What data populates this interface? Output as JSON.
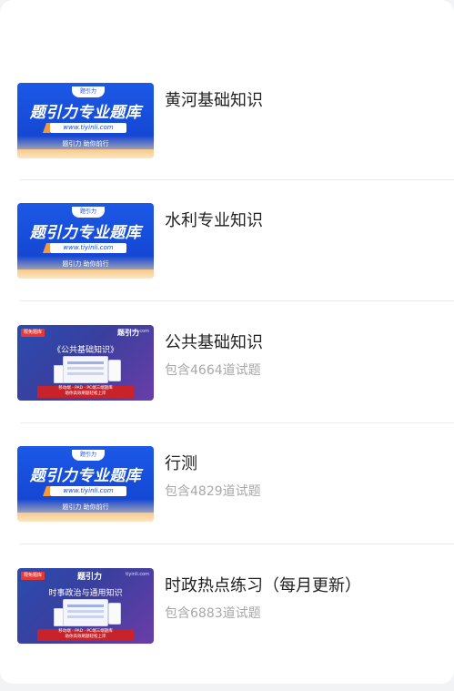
{
  "items": [
    {
      "title": "黄河基础知识",
      "subtitle": "",
      "thumb": {
        "style": "blue-banner",
        "logo": "题引力",
        "headline": "题引力专业题库",
        "url": "www.tiyinli.com",
        "slogan": "题引力 助你前行"
      }
    },
    {
      "title": "水利专业知识",
      "subtitle": "",
      "thumb": {
        "style": "blue-banner",
        "logo": "题引力",
        "headline": "题引力专业题库",
        "url": "www.tiyinli.com",
        "slogan": "题引力 助你前行"
      }
    },
    {
      "title": "公共基础知识",
      "subtitle": "包含4664道试题",
      "thumb": {
        "style": "purple-promo",
        "tag": "限免题库",
        "brand": "题引力",
        "domain": "tiyinli.com",
        "headline": "《公共基础知识》",
        "bar_line1": "移动端 · PAD · PC端三端题库",
        "bar_line2": "助你高效刷题轻松上岸"
      }
    },
    {
      "title": "行测",
      "subtitle": "包含4829道试题",
      "thumb": {
        "style": "blue-banner",
        "logo": "题引力",
        "headline": "题引力专业题库",
        "url": "www.tiyinli.com",
        "slogan": "题引力 助你前行"
      }
    },
    {
      "title": "时政热点练习（每月更新）",
      "subtitle": "包含6883道试题",
      "thumb": {
        "style": "purple-promo",
        "tag": "限免题库",
        "brand": "题引力",
        "domain": "tiyinli.com",
        "headline": "时事政治与通用知识",
        "bar_line1": "移动端 · PAD · PC端三端题库",
        "bar_line2": "助你高效刷题轻松上岸"
      }
    }
  ],
  "colors": {
    "accent_blue": "#1c59e6",
    "title_text": "#222222",
    "subtitle_text": "#a8a8a8",
    "tag_red": "#e53935"
  }
}
